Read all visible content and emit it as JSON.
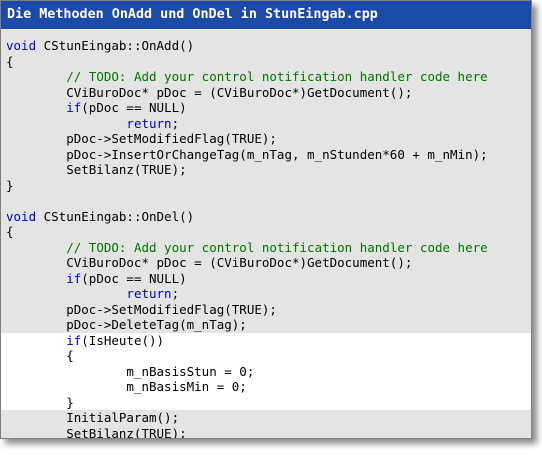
{
  "window": {
    "title": "Die Methoden OnAdd und OnDel in StunEingab.cpp"
  },
  "colors": {
    "titlebar_bg": "#1c4aa8",
    "code_bg": "#e4e4e4",
    "highlight_bg": "#ffffff",
    "keyword": "#0000cc",
    "comment": "#007700"
  },
  "code": {
    "lines": [
      [
        {
          "t": "void",
          "c": "kw"
        },
        {
          "t": " CStunEingab::OnAdd()"
        }
      ],
      [
        {
          "t": "{"
        }
      ],
      [
        {
          "t": "        "
        },
        {
          "t": "// TODO: Add your control notification handler code here",
          "c": "cm"
        }
      ],
      [
        {
          "t": "        CViBuroDoc* pDoc = (CViBuroDoc*)GetDocument();"
        }
      ],
      [
        {
          "t": "        "
        },
        {
          "t": "if",
          "c": "kw"
        },
        {
          "t": "(pDoc == NULL)"
        }
      ],
      [
        {
          "t": "                "
        },
        {
          "t": "return",
          "c": "kw"
        },
        {
          "t": ";"
        }
      ],
      [
        {
          "t": "        pDoc->SetModifiedFlag(TRUE);"
        }
      ],
      [
        {
          "t": "        pDoc->InsertOrChangeTag(m_nTag, m_nStunden*60 + m_nMin);"
        }
      ],
      [
        {
          "t": "        SetBilanz(TRUE);"
        }
      ],
      [
        {
          "t": "}"
        }
      ],
      [
        {
          "t": ""
        }
      ],
      [
        {
          "t": "void",
          "c": "kw"
        },
        {
          "t": " CStunEingab::OnDel()"
        }
      ],
      [
        {
          "t": "{"
        }
      ],
      [
        {
          "t": "        "
        },
        {
          "t": "// TODO: Add your control notification handler code here",
          "c": "cm"
        }
      ],
      [
        {
          "t": "        CViBuroDoc* pDoc = (CViBuroDoc*)GetDocument();"
        }
      ],
      [
        {
          "t": "        "
        },
        {
          "t": "if",
          "c": "kw"
        },
        {
          "t": "(pDoc == NULL)"
        }
      ],
      [
        {
          "t": "                "
        },
        {
          "t": "return",
          "c": "kw"
        },
        {
          "t": ";"
        }
      ],
      [
        {
          "t": "        pDoc->SetModifiedFlag(TRUE);"
        }
      ],
      [
        {
          "t": "        pDoc->DeleteTag(m_nTag);"
        }
      ],
      [
        {
          "t": "        "
        },
        {
          "t": "if",
          "c": "kw"
        },
        {
          "t": "(IsHeute())"
        }
      ],
      [
        {
          "t": "        {"
        }
      ],
      [
        {
          "t": "                m_nBasisStun = 0;"
        }
      ],
      [
        {
          "t": "                m_nBasisMin = 0;"
        }
      ],
      [
        {
          "t": "        }"
        }
      ],
      [
        {
          "t": "        InitialParam();"
        }
      ],
      [
        {
          "t": "        SetBilanz(TRUE);"
        }
      ],
      [
        {
          "t": "}"
        }
      ]
    ],
    "highlighted_lines": [
      19,
      20,
      21,
      22,
      23
    ]
  }
}
